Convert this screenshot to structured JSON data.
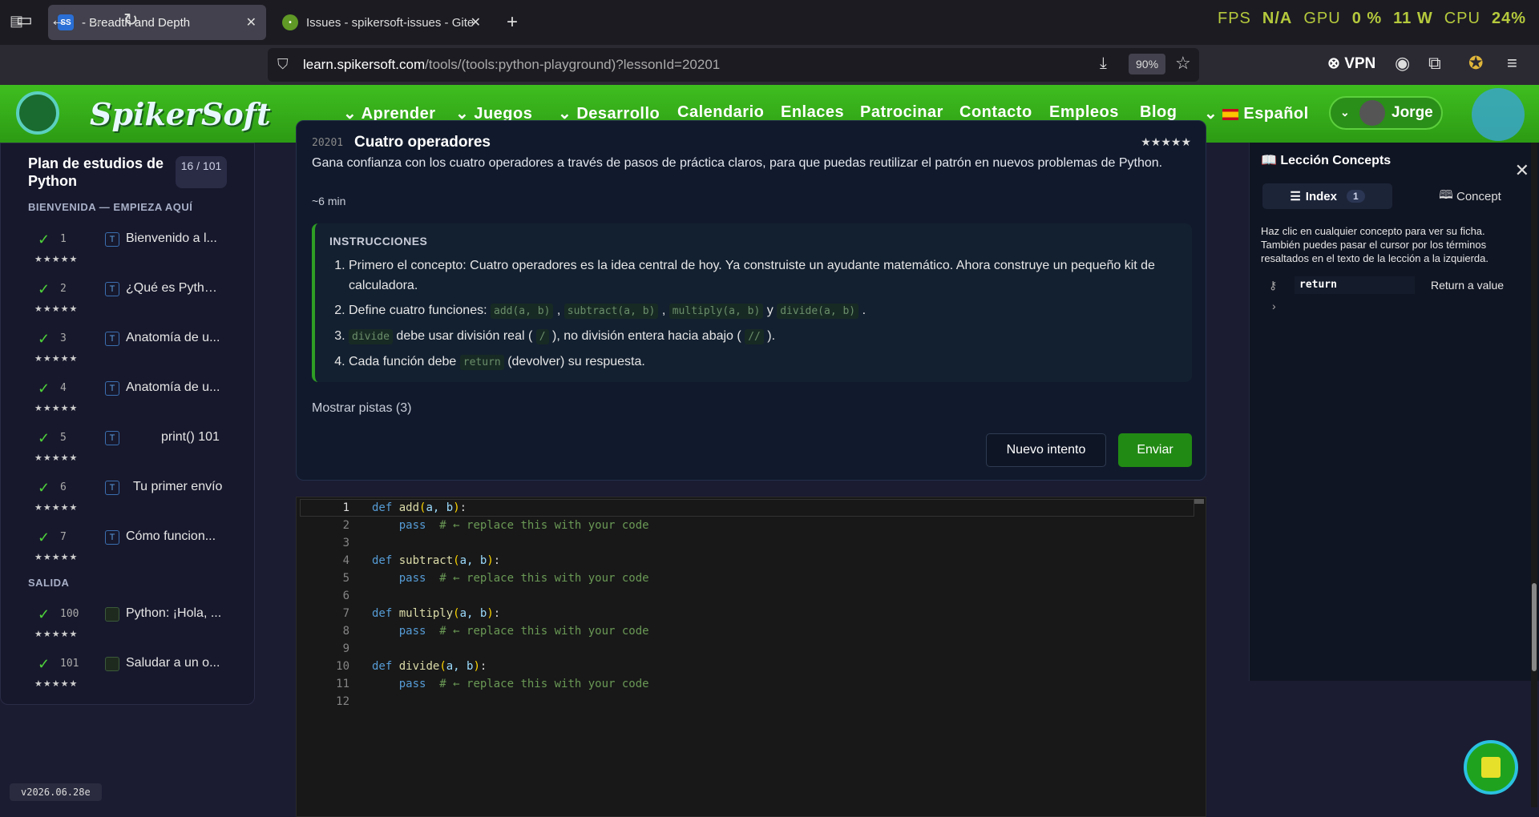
{
  "browser": {
    "tabs": [
      {
        "title": "- Breadth and Depth",
        "favicon": "SS"
      },
      {
        "title": "Issues - spikersoft-issues - Gitea"
      }
    ],
    "url_domain": "learn.spikersoft.com",
    "url_path": "/tools/(tools:python-playground)?lessonId=20201",
    "zoom": "90%",
    "vpn_label": "VPN",
    "sysmon": {
      "fps_label": "FPS",
      "fps_value": "N/A",
      "gpu_label": "GPU",
      "gpu_value": "0 %",
      "power": "11 W",
      "cpu_label": "CPU",
      "cpu_value": "24%"
    }
  },
  "site": {
    "logo": "SpikerSoft",
    "menu": [
      {
        "label": "Aprender",
        "dropdown": true
      },
      {
        "label": "Juegos",
        "dropdown": true
      },
      {
        "label": "Desarrollo",
        "dropdown": true
      },
      {
        "label": "Calendario"
      },
      {
        "label": "Enlaces"
      },
      {
        "label": "Patrocinar"
      },
      {
        "label": "Contacto"
      },
      {
        "label": "Empleos"
      },
      {
        "label": "Blog"
      },
      {
        "label": "Español",
        "dropdown": true
      }
    ],
    "user_name": "Jorge"
  },
  "sidebar": {
    "title": "Plan de estudios de Python",
    "count": "16 / 101",
    "sections": [
      {
        "label": "BIENVENIDA — EMPIEZA AQUÍ"
      },
      {
        "label": "SALIDA"
      }
    ],
    "lessons": [
      {
        "num": "1",
        "badge": "T",
        "label": "Bienvenido a l...",
        "stars": "★★★★★"
      },
      {
        "num": "2",
        "badge": "T",
        "label": "¿Qué es Pytho...",
        "stars": "★★★★★"
      },
      {
        "num": "3",
        "badge": "T",
        "label": "Anatomía de u...",
        "stars": "★★★★★"
      },
      {
        "num": "4",
        "badge": "T",
        "label": "Anatomía de u...",
        "stars": "★★★★★"
      },
      {
        "num": "5",
        "badge": "T",
        "label": "print() 101",
        "stars": "★★★★★"
      },
      {
        "num": "6",
        "badge": "T",
        "label": "Tu primer envío",
        "stars": "★★★★★"
      },
      {
        "num": "7",
        "badge": "T",
        "label": "Cómo funcion...",
        "stars": "★★★★★"
      },
      {
        "num": "100",
        "badge": "",
        "label": "Python: ¡Hola, ...",
        "stars": "★★★★★"
      },
      {
        "num": "101",
        "badge": "",
        "label": "Saludar a un o...",
        "stars": "★★★★★"
      }
    ],
    "version": "v2026.06.28e"
  },
  "lesson": {
    "id": "20201",
    "title": "Cuatro operadores",
    "stars": "★★★★★",
    "description": "Gana confianza con los cuatro operadores a través de pasos de práctica claros, para que puedas reutilizar el patrón en nuevos problemas de Python.",
    "duration": "~6 min",
    "instructions_heading": "INSTRUCCIONES",
    "instructions": {
      "s1": "Primero el concepto: Cuatro operadores es la idea central de hoy. Ya construiste un ayudante matemático. Ahora construye un pequeño kit de calculadora.",
      "s2_pre": "Define cuatro funciones:",
      "s2_c1": "add(a, b)",
      "s2_c2": "subtract(a, b)",
      "s2_c3": "multiply(a, b)",
      "s2_and": "y",
      "s2_c4": "divide(a, b)",
      "s3_c1": "divide",
      "s3_mid": "debe usar división real (",
      "s3_c2": "/",
      "s3_mid2": "), no división entera hacia abajo (",
      "s3_c3": "//",
      "s3_end": ").",
      "s4_pre": "Cada función debe",
      "s4_c": "return",
      "s4_post": "(devolver) su respuesta."
    },
    "hints_label": "Mostrar pistas (3)",
    "retry_label": "Nuevo intento",
    "submit_label": "Enviar"
  },
  "editor": {
    "lines": [
      {
        "n": "1",
        "code": "def add(a, b):"
      },
      {
        "n": "2",
        "code": "    pass  # ← replace this with your code"
      },
      {
        "n": "3",
        "code": ""
      },
      {
        "n": "4",
        "code": "def subtract(a, b):"
      },
      {
        "n": "5",
        "code": "    pass  # ← replace this with your code"
      },
      {
        "n": "6",
        "code": ""
      },
      {
        "n": "7",
        "code": "def multiply(a, b):"
      },
      {
        "n": "8",
        "code": "    pass  # ← replace this with your code"
      },
      {
        "n": "9",
        "code": ""
      },
      {
        "n": "10",
        "code": "def divide(a, b):"
      },
      {
        "n": "11",
        "code": "    pass  # ← replace this with your code"
      },
      {
        "n": "12",
        "code": ""
      }
    ]
  },
  "concepts": {
    "title": "Lección Concepts",
    "tab_index": "Index",
    "tab_index_count": "1",
    "tab_concept": "Concept",
    "help": "Haz clic en cualquier concepto para ver su ficha. También puedes pasar el cursor por los términos resaltados en el texto de la lección a la izquierda.",
    "items": [
      {
        "term": "return",
        "definition": "Return a value"
      }
    ]
  }
}
